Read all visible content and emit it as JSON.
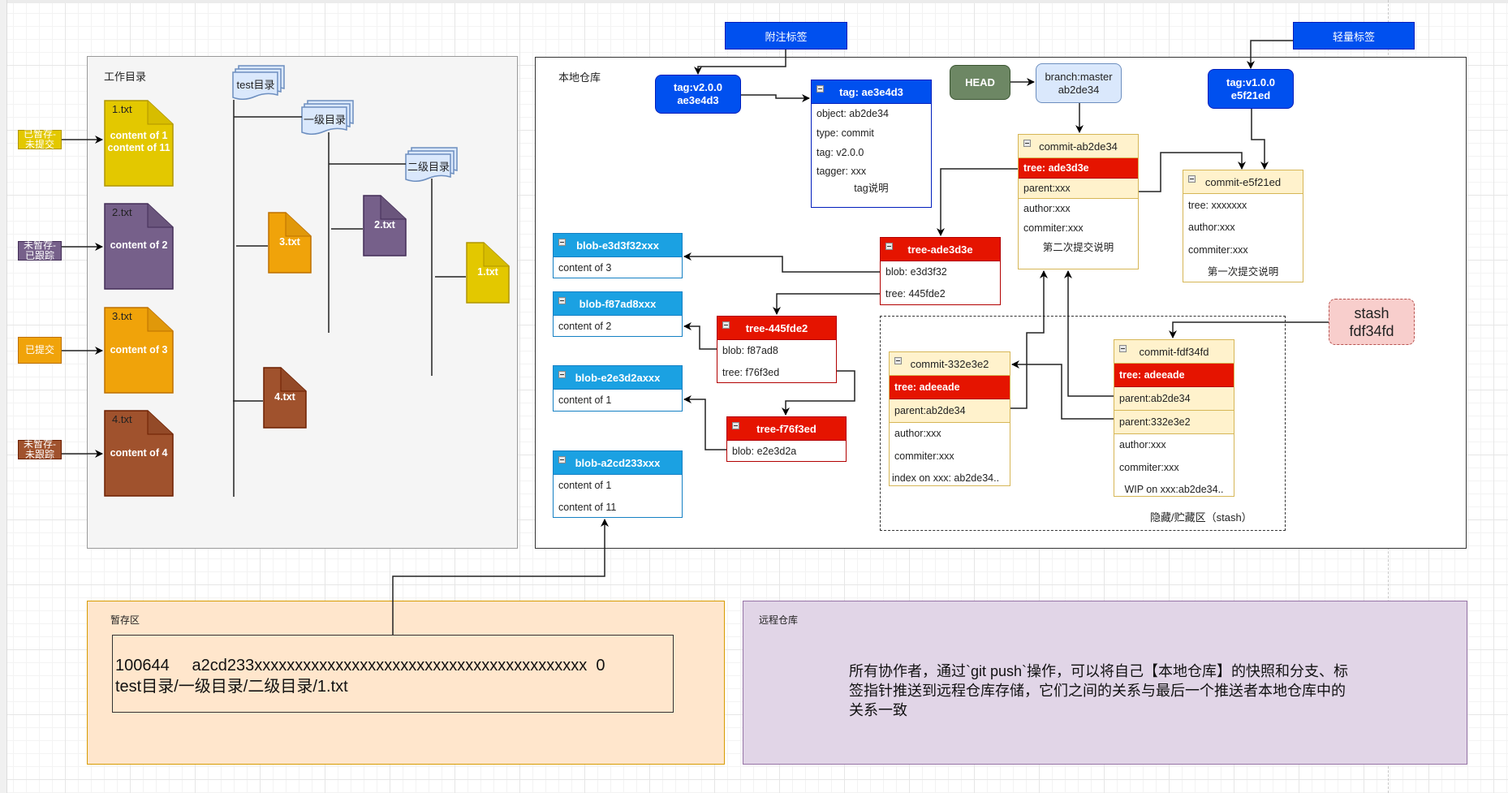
{
  "regions": {
    "working_dir": "工作目录",
    "local_repo": "本地仓库",
    "staging": "暂存区",
    "remote": "远程仓库",
    "stash_area": "隐藏/贮藏区（stash）"
  },
  "status_labels": [
    {
      "text": "已暂存-\n未提交",
      "color": "#e3c800"
    },
    {
      "text": "未暂存-\n已跟踪",
      "color": "#76608a"
    },
    {
      "text": "已提交",
      "color": "#f0a30a"
    },
    {
      "text": "未暂存-\n未跟踪",
      "color": "#a0522d"
    }
  ],
  "working_files": [
    {
      "name": "1.txt",
      "content": "content of 1\ncontent of 11"
    },
    {
      "name": "2.txt",
      "content": "content of 2"
    },
    {
      "name": "3.txt",
      "content": "content of 3"
    },
    {
      "name": "4.txt",
      "content": "content of 4"
    }
  ],
  "dir_tree": {
    "root": "test目录",
    "level1": "一级目录",
    "level2": "二级目录",
    "files": {
      "f1": "1.txt",
      "f2": "2.txt",
      "f3": "3.txt",
      "f4": "4.txt"
    }
  },
  "tag_labels": {
    "annotated": "附注标签",
    "lightweight": "轻量标签"
  },
  "refs": {
    "tag_v2": "tag:v2.0.0\nae3e4d3",
    "tag_v1": "tag:v1.0.0\ne5f21ed",
    "head": "HEAD",
    "branch": "branch:master\nab2de34",
    "stash": "stash\nfdf34fd"
  },
  "tag_object": {
    "title": "tag: ae3e4d3",
    "rows": [
      "object: ab2de34",
      "type: commit",
      "tag: v2.0.0",
      "tagger: xxx"
    ],
    "message": "tag说明"
  },
  "commits": {
    "ab2de34": {
      "title": "commit-ab2de34",
      "tree": "tree: ade3d3e",
      "parents": [
        "parent:xxx"
      ],
      "rows": [
        "author:xxx",
        "commiter:xxx"
      ],
      "message": "第二次提交说明"
    },
    "e5f21ed": {
      "title": "commit-e5f21ed",
      "rows": [
        "tree: xxxxxxx",
        "author:xxx",
        "commiter:xxx"
      ],
      "message": "第一次提交说明"
    },
    "332e3e2": {
      "title": "commit-332e3e2",
      "tree": "tree: adeeade",
      "parents": [
        "parent:ab2de34"
      ],
      "rows": [
        "author:xxx",
        "commiter:xxx"
      ],
      "message": "index on xxx:  ab2de34.."
    },
    "fdf34fd": {
      "title": "commit-fdf34fd",
      "tree": "tree: adeeade",
      "parents": [
        "parent:ab2de34",
        "parent:332e3e2"
      ],
      "rows": [
        "author:xxx",
        "commiter:xxx"
      ],
      "message": "WIP on xxx:ab2de34.."
    }
  },
  "trees": {
    "ade3d3e": {
      "title": "tree-ade3d3e",
      "rows": [
        "blob: e3d3f32",
        "tree: 445fde2"
      ]
    },
    "445fde2": {
      "title": "tree-445fde2",
      "rows": [
        "blob: f87ad8",
        "tree: f76f3ed"
      ]
    },
    "f76f3ed": {
      "title": "tree-f76f3ed",
      "rows": [
        "blob: e2e3d2a"
      ]
    }
  },
  "blobs": {
    "e3d3f32": {
      "title": "blob-e3d3f32xxx",
      "rows": [
        "content of 3"
      ]
    },
    "f87ad8": {
      "title": "blob-f87ad8xxx",
      "rows": [
        "content of 2"
      ]
    },
    "e2e3d2a": {
      "title": "blob-e2e3d2axxx",
      "rows": [
        "content of 1"
      ]
    },
    "a2cd233": {
      "title": "blob-a2cd233xxx",
      "rows": [
        "content of 1",
        "content of 11"
      ]
    }
  },
  "staging_entry": "100644     a2cd233xxxxxxxxxxxxxxxxxxxxxxxxxxxxxxxxxxxxxxxxx  0\ntest目录/一级目录/二级目录/1.txt",
  "remote_description": "所有协作者，通过`git push`操作，可以将自己【本地仓库】的快照和分支、标签指针推送到远程仓库存储，它们之间的关系与最后一个推送者本地仓库中的关系一致",
  "colors": {
    "yellow": "#e3c800",
    "purple": "#76608a",
    "orange": "#f0a30a",
    "brown": "#a0522d",
    "blue": "#0050ef",
    "blob_blue": "#1ba1e2",
    "tree_red": "#e51400",
    "commit_yellow": "#fff2cc",
    "head_green": "#6d8764",
    "branch_blue": "#dae8fc",
    "stash_pink": "#f8cecc",
    "staging_bg": "#ffe6cc",
    "remote_bg": "#e1d5e7"
  }
}
